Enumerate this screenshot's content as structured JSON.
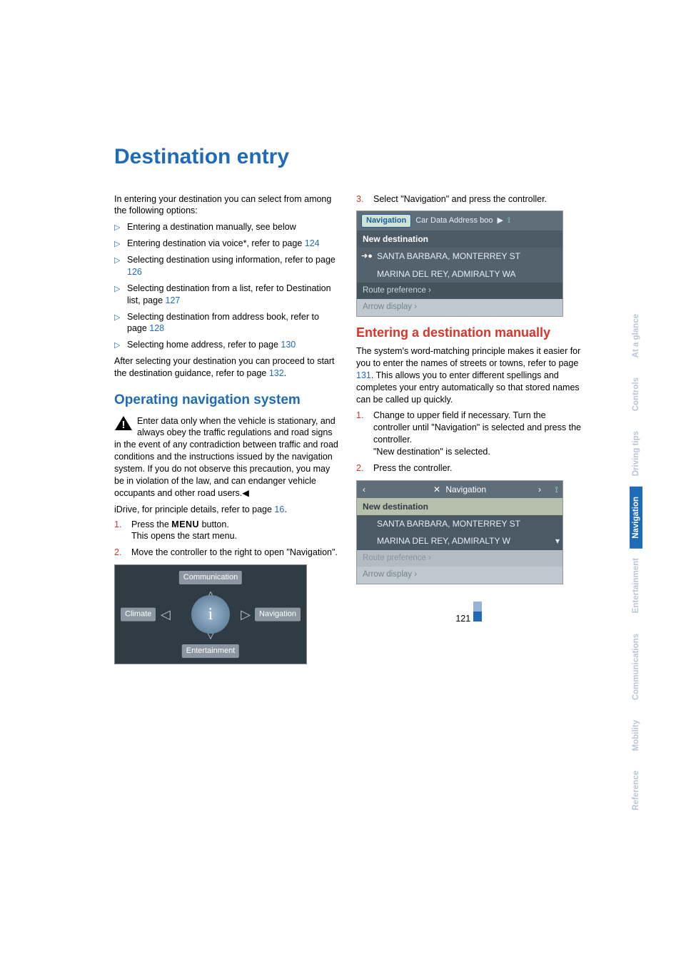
{
  "title": "Destination entry",
  "intro": "In entering your destination you can select from among the following options:",
  "options": [
    {
      "text": "Entering a destination manually, see below",
      "page": ""
    },
    {
      "text": "Entering destination via voice*, refer to page ",
      "page": "124"
    },
    {
      "text": "Selecting destination using information, refer to page ",
      "page": "126"
    },
    {
      "text": "Selecting destination from a list, refer to Destination list, page ",
      "page": "127"
    },
    {
      "text": "Selecting destination from address book, refer to page ",
      "page": "128"
    },
    {
      "text": "Selecting home address, refer to page ",
      "page": "130"
    }
  ],
  "after_select": {
    "pre": "After selecting your destination you can proceed to start the destination guidance, refer to page ",
    "page": "132",
    "post": "."
  },
  "h2_operating": "Operating navigation system",
  "warn_text": "Enter data only when the vehicle is stationary, and always obey the traffic regulations and road signs in the event of any contradiction between traffic and road conditions and the instructions issued by the navigation system. If you do not observe this precaution, you may be in violation of the law, and can endanger vehicle occupants and other road users.",
  "idrive_line": {
    "pre": "iDrive, for principle details, refer to page ",
    "page": "16",
    "post": "."
  },
  "steps_left": [
    {
      "n": "1.",
      "pre": "Press the ",
      "menu": "MENU",
      "post": " button.",
      "sub": "This opens the start menu."
    },
    {
      "n": "2.",
      "pre": "Move the controller to the right to open \"Navigation\".",
      "menu": "",
      "post": "",
      "sub": ""
    }
  ],
  "idrive_labels": {
    "top": "Communication",
    "bottom": "Entertainment",
    "left": "Climate",
    "right": "Navigation"
  },
  "right_step3": {
    "n": "3.",
    "text": "Select \"Navigation\" and press the controller."
  },
  "nav1": {
    "tab": "Navigation",
    "other_tabs": "Car Data  Address boo",
    "new_dest": "New destination",
    "item1": "SANTA BARBARA, MONTERREY ST",
    "item2": "MARINA DEL REY, ADMIRALTY WA",
    "pref": "Route preference  ›",
    "arrow": "Arrow display  ›"
  },
  "h2_manual": "Entering a destination manually",
  "manual_para": {
    "pre": "The system's word-matching principle makes it easier for you to enter the names of streets or towns, refer to page ",
    "page": "131",
    "post": ". This allows you to enter different spellings and completes your entry automatically so that stored names can be called up quickly."
  },
  "steps_right": [
    {
      "n": "1.",
      "text": "Change to upper field if necessary. Turn the controller until \"Navigation\" is selected and press the controller.",
      "sub": "\"New destination\" is selected."
    },
    {
      "n": "2.",
      "text": "Press the controller.",
      "sub": ""
    }
  ],
  "nav2": {
    "header": "Navigation",
    "new_dest": "New destination",
    "item1": "SANTA BARBARA, MONTERREY ST",
    "item2": "MARINA DEL REY, ADMIRALTY W",
    "pref": "Route preference ›",
    "arrow": "Arrow display ›"
  },
  "page_number": "121",
  "sidebar": [
    "Reference",
    "Mobility",
    "Communications",
    "Entertainment",
    "Navigation",
    "Driving tips",
    "Controls",
    "At a glance"
  ],
  "sidebar_active_index": 4
}
